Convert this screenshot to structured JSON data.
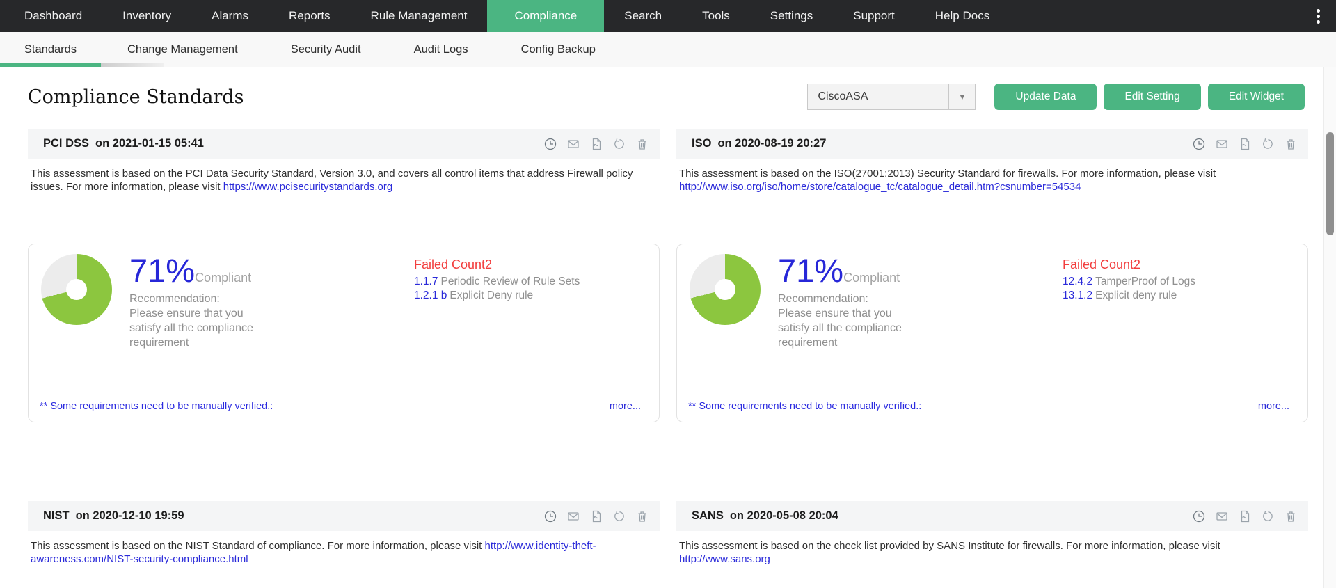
{
  "topnav": {
    "items": [
      {
        "label": "Dashboard",
        "active": false
      },
      {
        "label": "Inventory",
        "active": false
      },
      {
        "label": "Alarms",
        "active": false
      },
      {
        "label": "Reports",
        "active": false
      },
      {
        "label": "Rule Management",
        "active": false
      },
      {
        "label": "Compliance",
        "active": true
      },
      {
        "label": "Search",
        "active": false
      },
      {
        "label": "Tools",
        "active": false
      },
      {
        "label": "Settings",
        "active": false
      },
      {
        "label": "Support",
        "active": false
      },
      {
        "label": "Help Docs",
        "active": false
      }
    ]
  },
  "subnav": {
    "items": [
      {
        "label": "Standards",
        "active": true
      },
      {
        "label": "Change Management",
        "active": false
      },
      {
        "label": "Security Audit",
        "active": false
      },
      {
        "label": "Audit Logs",
        "active": false
      },
      {
        "label": "Config Backup",
        "active": false
      }
    ]
  },
  "page": {
    "title": "Compliance Standards"
  },
  "controls": {
    "device_selector": {
      "value": "CiscoASA"
    },
    "buttons": [
      {
        "label": "Update Data"
      },
      {
        "label": "Edit Setting"
      },
      {
        "label": "Edit Widget"
      }
    ]
  },
  "header_icon_names": [
    "schedule-icon",
    "email-icon",
    "pdf-export-icon",
    "refresh-icon",
    "delete-icon"
  ],
  "widgets": [
    {
      "title": "PCI DSS",
      "timestamp_label": "on 2021-01-15 05:41",
      "description": "This assessment is based on the PCI Data Security Standard, Version 3.0, and covers all control items that address Firewall policy issues. For more information, please visit ",
      "link": "https://www.pcisecuritystandards.org",
      "percent_label": "71%",
      "percent_value": 71,
      "compliant_label": "Compliant",
      "recommendation_title": "Recommendation:",
      "recommendation_lines": [
        "Please ensure that you",
        "satisfy all the compliance",
        "requirement"
      ],
      "failed_title": "Failed Count2",
      "failed_items": [
        {
          "code": "1.1.7",
          "text": "Periodic Review of Rule Sets"
        },
        {
          "code": "1.2.1 b",
          "text": "Explicit Deny rule"
        }
      ],
      "footnote": "** Some requirements need to be manually verified.:",
      "more_label": "more..."
    },
    {
      "title": "ISO",
      "timestamp_label": "on 2020-08-19 20:27",
      "description": "This assessment is based on the ISO(27001:2013) Security Standard for firewalls. For more information, please visit ",
      "link": "http://www.iso.org/iso/home/store/catalogue_tc/catalogue_detail.htm?csnumber=54534",
      "percent_label": "71%",
      "percent_value": 71,
      "compliant_label": "Compliant",
      "recommendation_title": "Recommendation:",
      "recommendation_lines": [
        "Please ensure that you",
        "satisfy all the compliance",
        "requirement"
      ],
      "failed_title": "Failed Count2",
      "failed_items": [
        {
          "code": "12.4.2",
          "text": "TamperProof of Logs"
        },
        {
          "code": "13.1.2",
          "text": "Explicit deny rule"
        }
      ],
      "footnote": "** Some requirements need to be manually verified.:",
      "more_label": "more..."
    },
    {
      "title": "NIST",
      "timestamp_label": "on 2020-12-10 19:59",
      "description": "This assessment is based on the NIST Standard of compliance. For more information, please visit ",
      "link": "http://www.identity-theft-awareness.com/NIST-security-compliance.html"
    },
    {
      "title": "SANS",
      "timestamp_label": "on 2020-05-08 20:04",
      "description": "This assessment is based on the check list provided by SANS Institute for firewalls. For more information, please visit ",
      "link": "http://www.sans.org"
    }
  ],
  "colors": {
    "accent_green": "#4bb582",
    "donut_green": "#8cc63f",
    "donut_rest": "#ececec",
    "percent_blue": "#2727d8",
    "link_blue": "#2a2ad9",
    "failed_red": "#f23d3d",
    "topnav_bg": "#27282a"
  }
}
